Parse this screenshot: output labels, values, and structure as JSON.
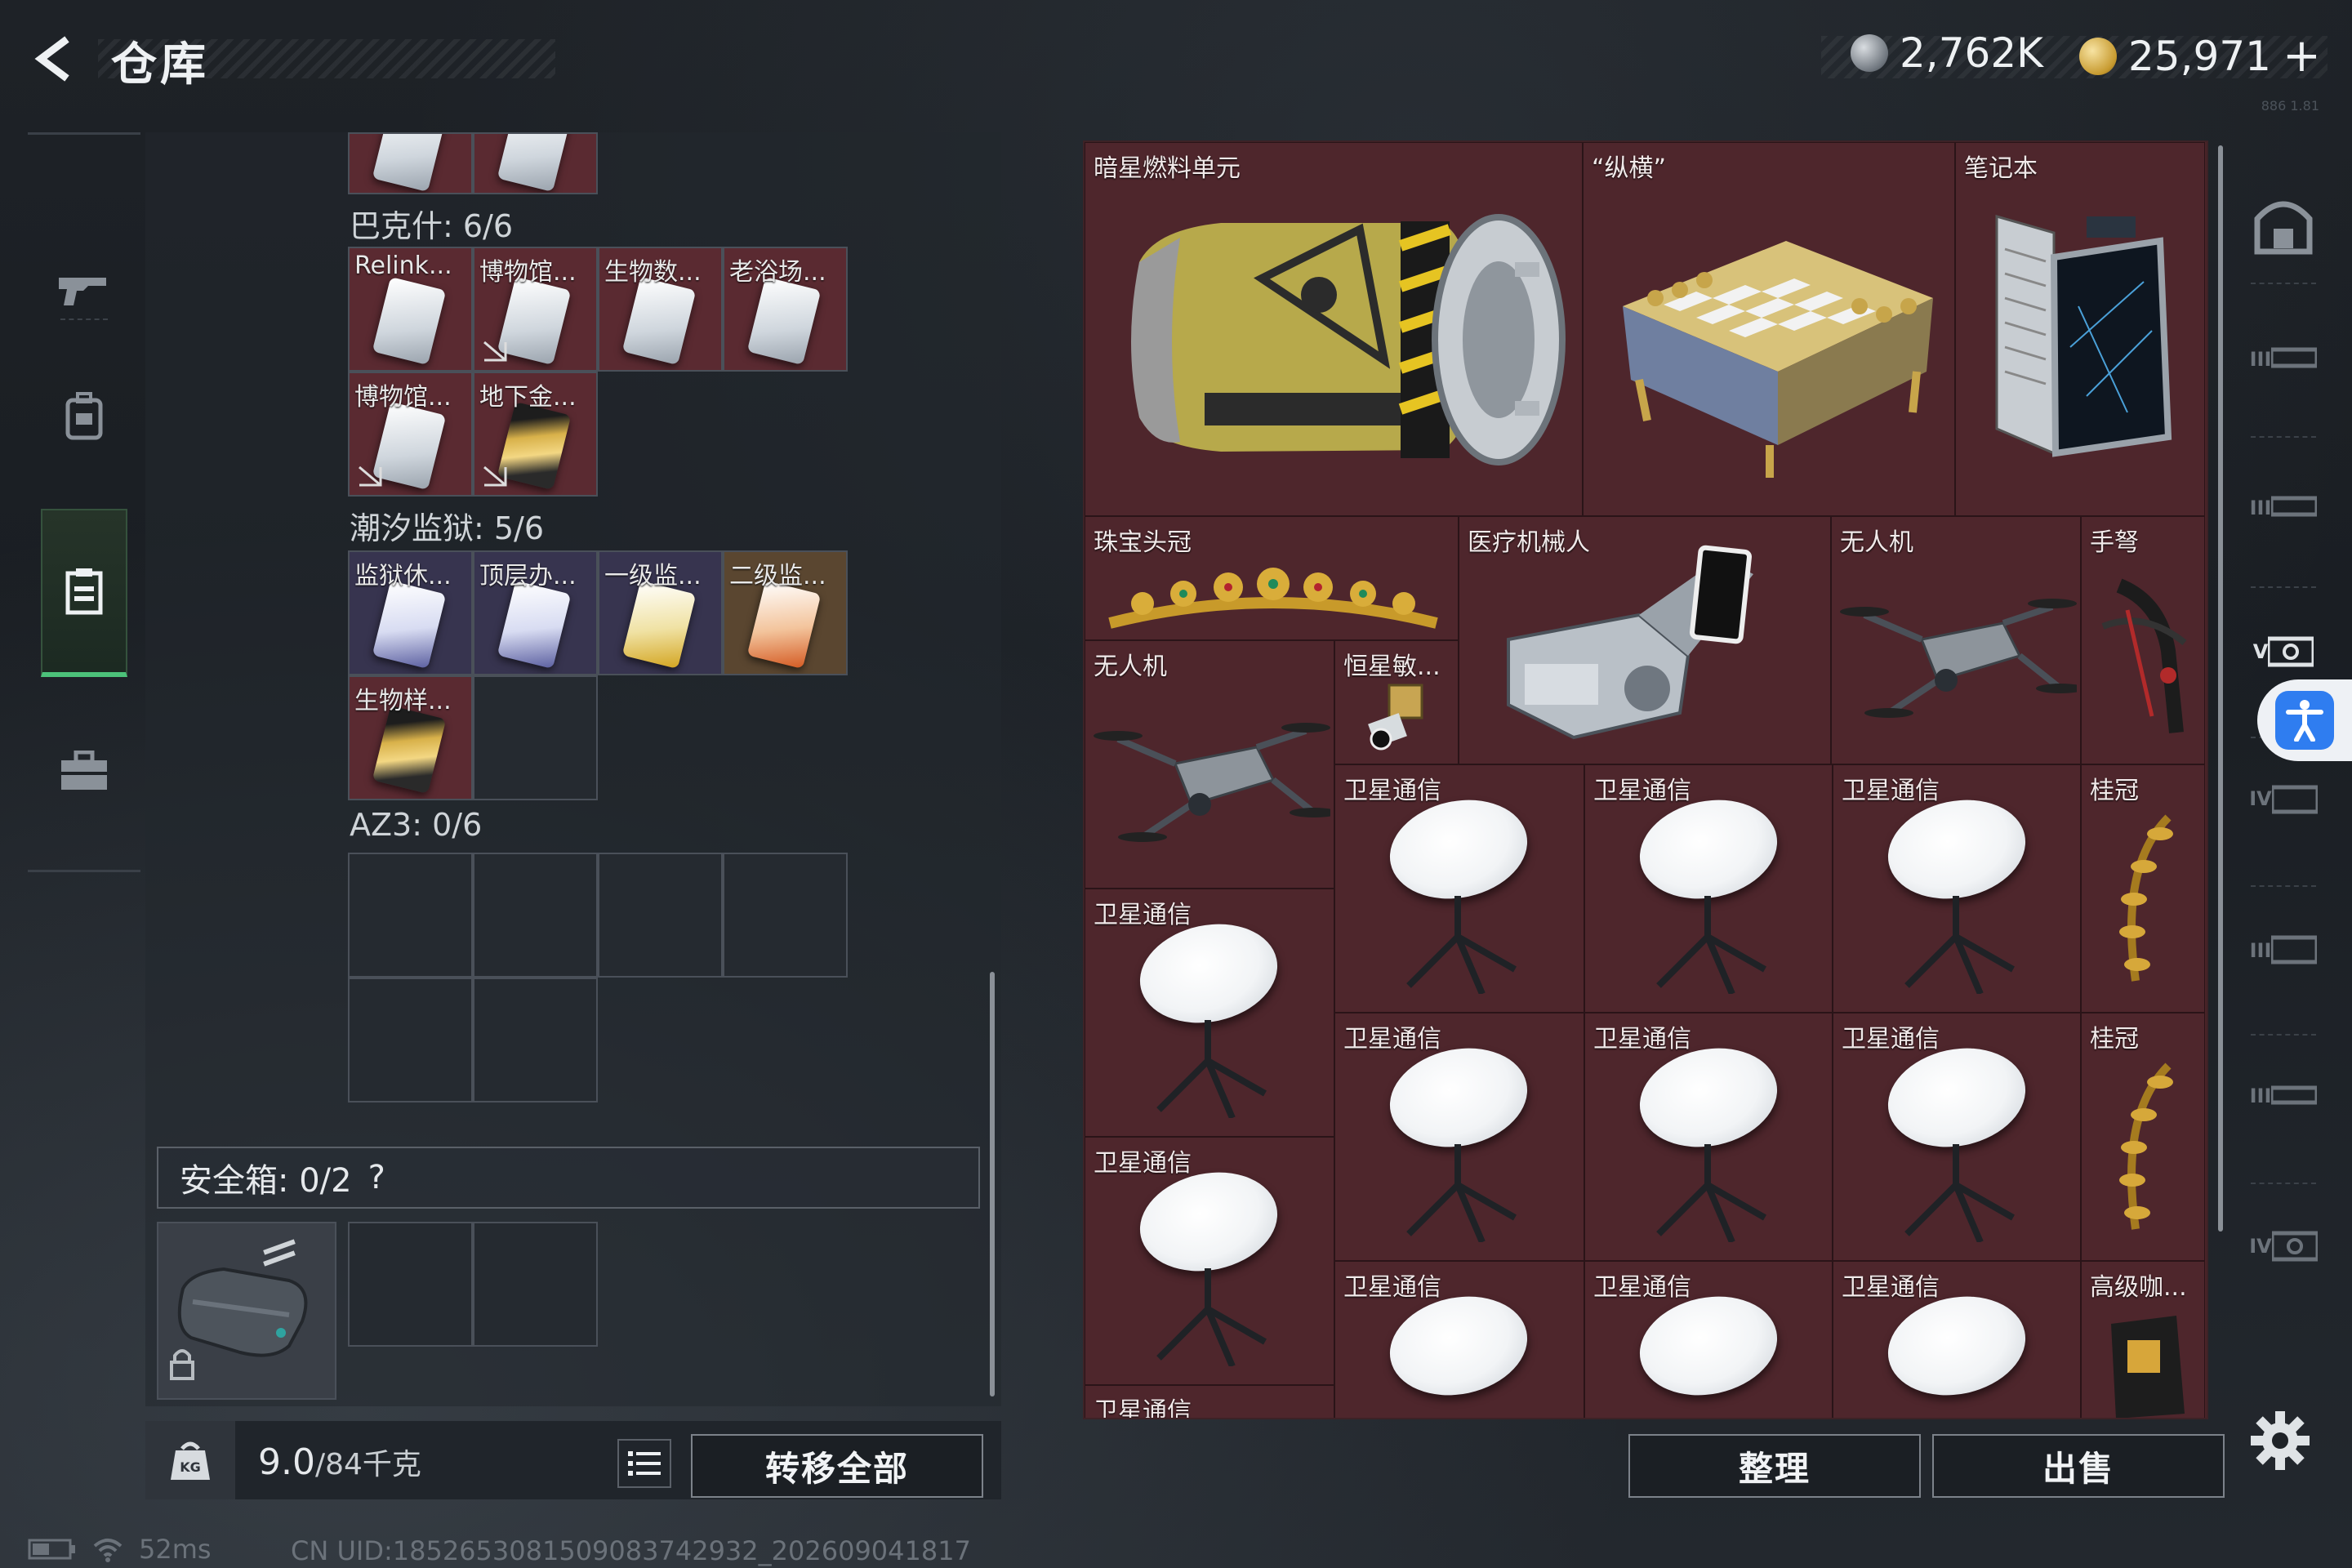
{
  "header": {
    "title": "仓库",
    "currency_silver": "2,762K",
    "currency_gold": "25,971",
    "add_label": "+",
    "tiny_text": "886 1.81"
  },
  "backpack": {
    "sections": [
      {
        "label": "巴克什: 6/6",
        "items": [
          "Relink...",
          "博物馆...",
          "生物数...",
          "老浴场...",
          "博物馆...",
          "地下金..."
        ]
      },
      {
        "label": "潮汐监狱: 5/6",
        "items": [
          "监狱休...",
          "顶层办...",
          "一级监...",
          "二级监...",
          "生物样..."
        ]
      },
      {
        "label": "AZ3: 0/6",
        "items": []
      }
    ],
    "safe_box": {
      "label": "安全箱: 0/2",
      "help": "?"
    },
    "weight_value": "9.0",
    "weight_max": "/84千克",
    "weight_icon_text": "KG",
    "transfer_all": "转移全部"
  },
  "storage": {
    "items": [
      {
        "label": "暗星燃料单元"
      },
      {
        "label": "“纵横”"
      },
      {
        "label": "笔记本"
      },
      {
        "label": "珠宝头冠"
      },
      {
        "label": "医疗机械人"
      },
      {
        "label": "无人机"
      },
      {
        "label": "手弩"
      },
      {
        "label": "无人机"
      },
      {
        "label": "恒星敏..."
      },
      {
        "label": "卫星通信"
      },
      {
        "label": "卫星通信"
      },
      {
        "label": "卫星通信"
      },
      {
        "label": "桂冠"
      },
      {
        "label": "卫星通信"
      },
      {
        "label": "卫星通信"
      },
      {
        "label": "卫星通信"
      },
      {
        "label": "卫星通信"
      },
      {
        "label": "桂冠"
      },
      {
        "label": "卫星通信"
      },
      {
        "label": "卫星通信"
      },
      {
        "label": "卫星通信"
      },
      {
        "label": "卫星通信"
      },
      {
        "label": "高级咖..."
      },
      {
        "label": "卫星通信"
      }
    ],
    "sort_label": "整理",
    "sell_label": "出售"
  },
  "right_tabs": [
    "III",
    "III",
    "V",
    "IV",
    "III",
    "III",
    "IV"
  ],
  "status": {
    "ping": "52ms",
    "uid": "CN UID:1852653081509083742932_202609041817"
  },
  "colors": {
    "accent_green": "#4cc27a",
    "storage_red": "#4e262c",
    "relic_red": "#5a2a31",
    "access_blue": "#2f7df0"
  }
}
